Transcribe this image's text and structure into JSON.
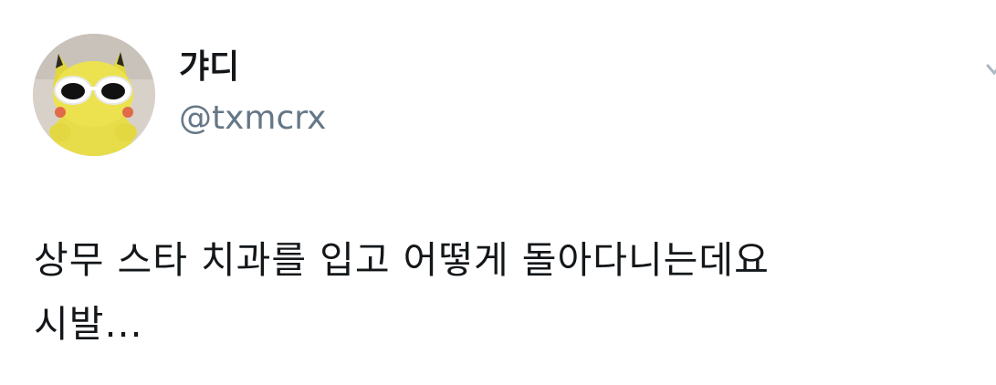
{
  "user": {
    "display_name": "갸디",
    "handle": "@txmcrx"
  },
  "tweet": {
    "line1": "상무 스타 치과를 입고 어떻게 돌아다니는데요",
    "line2": "시발..."
  },
  "icons": {
    "avatar": "avatar-yellow-plush-with-sunglasses",
    "menu": "chevron-down-icon"
  },
  "colors": {
    "name": "#14171a",
    "handle": "#657786",
    "text": "#14171a",
    "background": "#ffffff"
  }
}
